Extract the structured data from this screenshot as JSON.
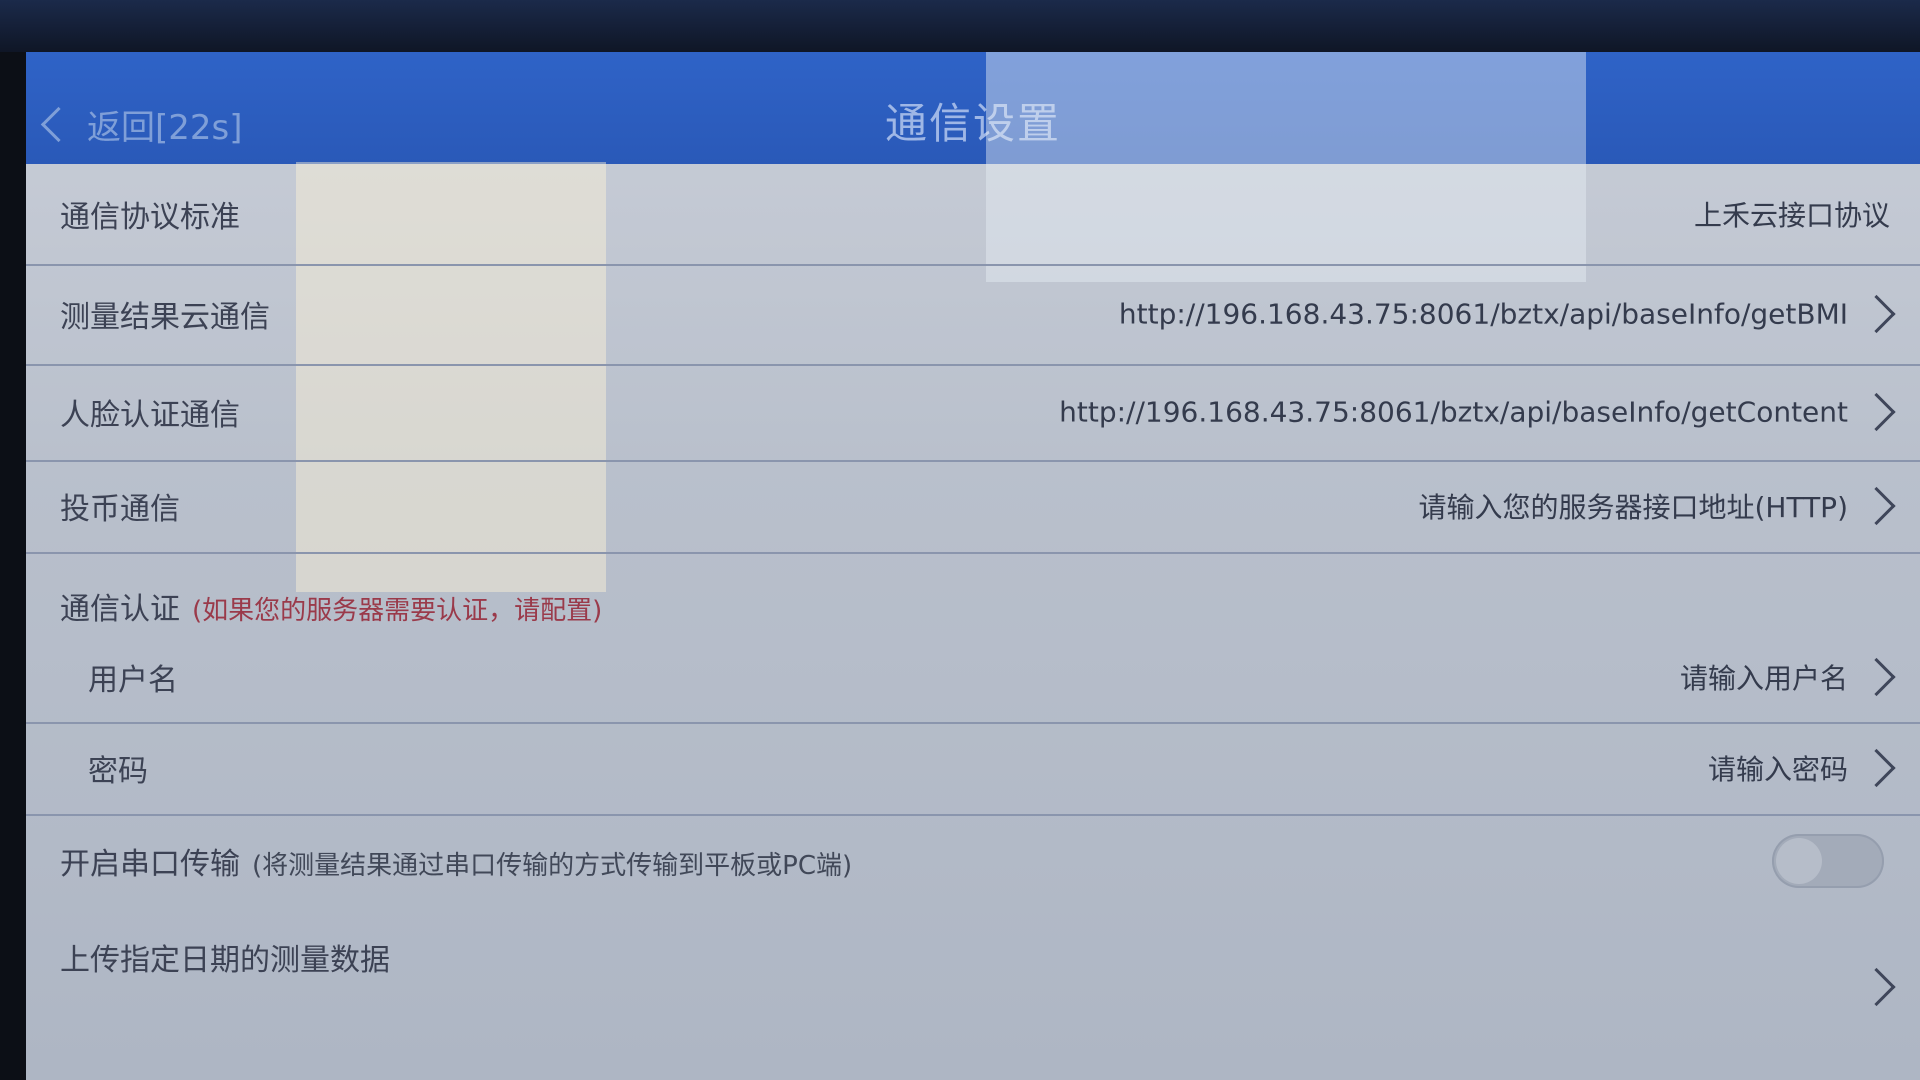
{
  "header": {
    "back_label": "返回[22s]",
    "title": "通信设置"
  },
  "rows": {
    "protocol": {
      "label": "通信协议标准",
      "value": "上禾云接口协议"
    },
    "cloud": {
      "label": "测量结果云通信",
      "value": "http://196.168.43.75:8061/bztx/api/baseInfo/getBMI"
    },
    "face": {
      "label": "人脸认证通信",
      "value": "http://196.168.43.75:8061/bztx/api/baseInfo/getContent"
    },
    "coin": {
      "label": "投币通信",
      "value": "请输入您的服务器接口地址(HTTP)"
    }
  },
  "auth": {
    "label": "通信认证",
    "hint": "(如果您的服务器需要认证，请配置)",
    "username": {
      "label": "用户名",
      "placeholder": "请输入用户名"
    },
    "password": {
      "label": "密码",
      "placeholder": "请输入密码"
    }
  },
  "serial": {
    "label": "开启串口传输",
    "hint": "(将测量结果通过串口传输的方式传输到平板或PC端)",
    "enabled": false
  },
  "upload": {
    "label": "上传指定日期的测量数据"
  },
  "colors": {
    "header_bg": "#2f63c7",
    "hint_red": "#9a3a4a"
  }
}
